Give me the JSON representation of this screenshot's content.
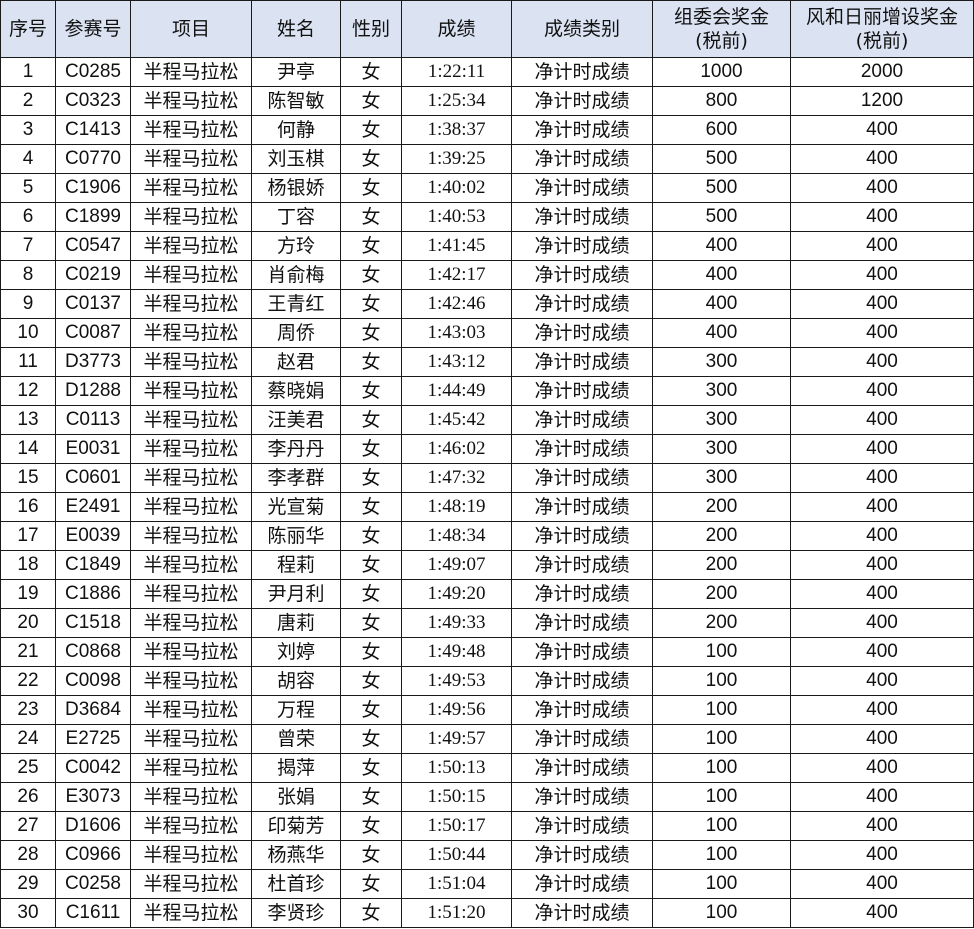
{
  "table": {
    "headers": [
      {
        "line1": "序号",
        "line2": ""
      },
      {
        "line1": "参赛号",
        "line2": ""
      },
      {
        "line1": "项目",
        "line2": ""
      },
      {
        "line1": "姓名",
        "line2": ""
      },
      {
        "line1": "性别",
        "line2": ""
      },
      {
        "line1": "成绩",
        "line2": ""
      },
      {
        "line1": "成绩类别",
        "line2": ""
      },
      {
        "line1": "组委会奖金",
        "line2": "(税前)"
      },
      {
        "line1": "风和日丽增设奖金",
        "line2": "(税前)"
      }
    ],
    "rows": [
      [
        "1",
        "C0285",
        "半程马拉松",
        "尹亭",
        "女",
        "1:22:11",
        "净计时成绩",
        "1000",
        "2000"
      ],
      [
        "2",
        "C0323",
        "半程马拉松",
        "陈智敏",
        "女",
        "1:25:34",
        "净计时成绩",
        "800",
        "1200"
      ],
      [
        "3",
        "C1413",
        "半程马拉松",
        "何静",
        "女",
        "1:38:37",
        "净计时成绩",
        "600",
        "400"
      ],
      [
        "4",
        "C0770",
        "半程马拉松",
        "刘玉棋",
        "女",
        "1:39:25",
        "净计时成绩",
        "500",
        "400"
      ],
      [
        "5",
        "C1906",
        "半程马拉松",
        "杨银娇",
        "女",
        "1:40:02",
        "净计时成绩",
        "500",
        "400"
      ],
      [
        "6",
        "C1899",
        "半程马拉松",
        "丁容",
        "女",
        "1:40:53",
        "净计时成绩",
        "500",
        "400"
      ],
      [
        "7",
        "C0547",
        "半程马拉松",
        "方玲",
        "女",
        "1:41:45",
        "净计时成绩",
        "400",
        "400"
      ],
      [
        "8",
        "C0219",
        "半程马拉松",
        "肖俞梅",
        "女",
        "1:42:17",
        "净计时成绩",
        "400",
        "400"
      ],
      [
        "9",
        "C0137",
        "半程马拉松",
        "王青红",
        "女",
        "1:42:46",
        "净计时成绩",
        "400",
        "400"
      ],
      [
        "10",
        "C0087",
        "半程马拉松",
        "周侨",
        "女",
        "1:43:03",
        "净计时成绩",
        "400",
        "400"
      ],
      [
        "11",
        "D3773",
        "半程马拉松",
        "赵君",
        "女",
        "1:43:12",
        "净计时成绩",
        "300",
        "400"
      ],
      [
        "12",
        "D1288",
        "半程马拉松",
        "蔡晓娟",
        "女",
        "1:44:49",
        "净计时成绩",
        "300",
        "400"
      ],
      [
        "13",
        "C0113",
        "半程马拉松",
        "汪美君",
        "女",
        "1:45:42",
        "净计时成绩",
        "300",
        "400"
      ],
      [
        "14",
        "E0031",
        "半程马拉松",
        "李丹丹",
        "女",
        "1:46:02",
        "净计时成绩",
        "300",
        "400"
      ],
      [
        "15",
        "C0601",
        "半程马拉松",
        "李孝群",
        "女",
        "1:47:32",
        "净计时成绩",
        "300",
        "400"
      ],
      [
        "16",
        "E2491",
        "半程马拉松",
        "光宣菊",
        "女",
        "1:48:19",
        "净计时成绩",
        "200",
        "400"
      ],
      [
        "17",
        "E0039",
        "半程马拉松",
        "陈丽华",
        "女",
        "1:48:34",
        "净计时成绩",
        "200",
        "400"
      ],
      [
        "18",
        "C1849",
        "半程马拉松",
        "程莉",
        "女",
        "1:49:07",
        "净计时成绩",
        "200",
        "400"
      ],
      [
        "19",
        "C1886",
        "半程马拉松",
        "尹月利",
        "女",
        "1:49:20",
        "净计时成绩",
        "200",
        "400"
      ],
      [
        "20",
        "C1518",
        "半程马拉松",
        "唐莉",
        "女",
        "1:49:33",
        "净计时成绩",
        "200",
        "400"
      ],
      [
        "21",
        "C0868",
        "半程马拉松",
        "刘婷",
        "女",
        "1:49:48",
        "净计时成绩",
        "100",
        "400"
      ],
      [
        "22",
        "C0098",
        "半程马拉松",
        "胡容",
        "女",
        "1:49:53",
        "净计时成绩",
        "100",
        "400"
      ],
      [
        "23",
        "D3684",
        "半程马拉松",
        "万程",
        "女",
        "1:49:56",
        "净计时成绩",
        "100",
        "400"
      ],
      [
        "24",
        "E2725",
        "半程马拉松",
        "曾荣",
        "女",
        "1:49:57",
        "净计时成绩",
        "100",
        "400"
      ],
      [
        "25",
        "C0042",
        "半程马拉松",
        "揭萍",
        "女",
        "1:50:13",
        "净计时成绩",
        "100",
        "400"
      ],
      [
        "26",
        "E3073",
        "半程马拉松",
        "张娟",
        "女",
        "1:50:15",
        "净计时成绩",
        "100",
        "400"
      ],
      [
        "27",
        "D1606",
        "半程马拉松",
        "印菊芳",
        "女",
        "1:50:17",
        "净计时成绩",
        "100",
        "400"
      ],
      [
        "28",
        "C0966",
        "半程马拉松",
        "杨燕华",
        "女",
        "1:50:44",
        "净计时成绩",
        "100",
        "400"
      ],
      [
        "29",
        "C0258",
        "半程马拉松",
        "杜首珍",
        "女",
        "1:51:04",
        "净计时成绩",
        "100",
        "400"
      ],
      [
        "30",
        "C1611",
        "半程马拉松",
        "李贤珍",
        "女",
        "1:51:20",
        "净计时成绩",
        "100",
        "400"
      ]
    ]
  },
  "colors": {
    "header_background": "#dbe3f3",
    "border": "#1a1a1a",
    "text": "#111111"
  }
}
